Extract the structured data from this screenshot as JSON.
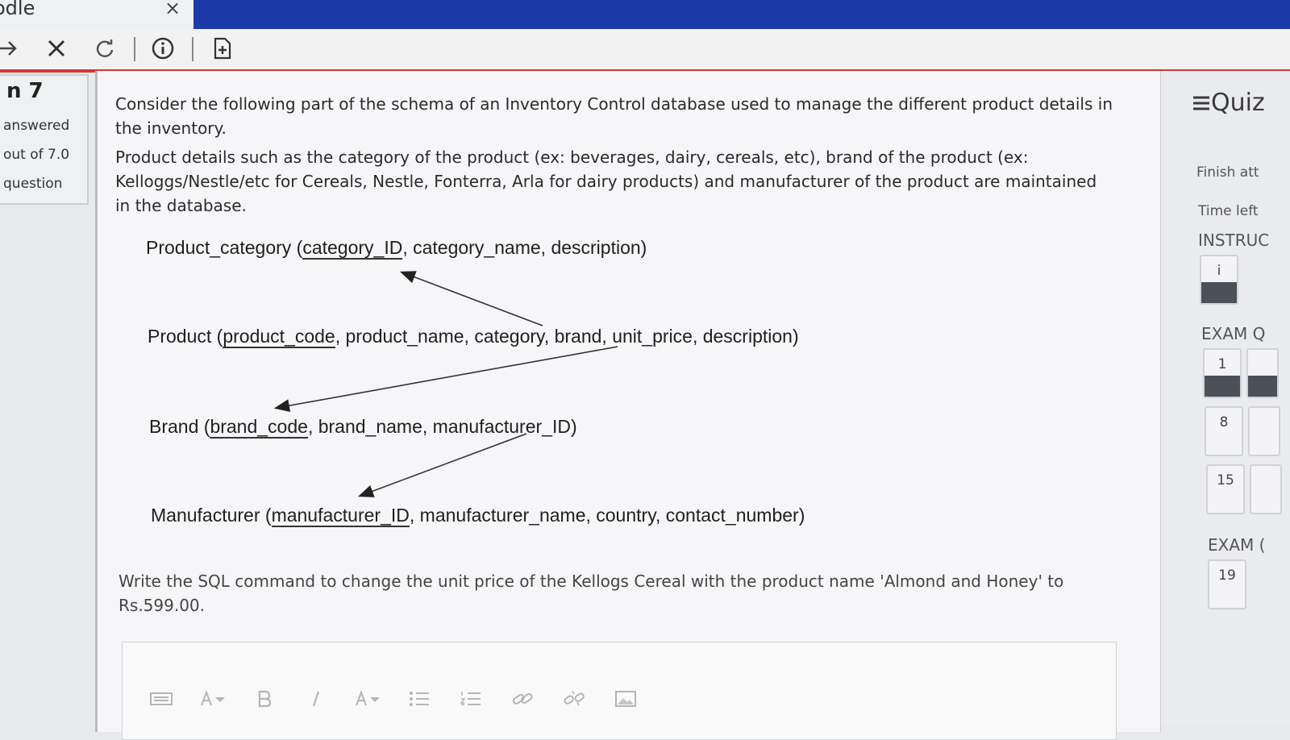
{
  "browser": {
    "tab_title": "odle",
    "tab_close": "×"
  },
  "question_info": {
    "number": "n 7",
    "status": "answered",
    "marks": "out of 7.0",
    "flag": "question"
  },
  "question": {
    "intro": "Consider the following part of the schema of an Inventory Control database used to manage the different product details in the inventory.",
    "details": "Product details such as the category of the product (ex: beverages, dairy, cereals, etc), brand of the product (ex: Kelloggs/Nestle/etc for Cereals, Nestle, Fonterra, Arla for dairy products) and manufacturer of the product are maintained in the database.",
    "schema": {
      "product_category": {
        "name": "Product_category (",
        "pk": "category_ID",
        "rest": ", category_name, description)"
      },
      "product": {
        "name": "Product (",
        "pk": "product_code",
        "rest": ", product_name, category, brand, unit_price, description)"
      },
      "brand": {
        "name": "Brand (",
        "pk": "brand_code",
        "rest": ", brand_name, manufacturer_ID)"
      },
      "manufacturer": {
        "name": "Manufacturer (",
        "pk": "manufacturer_ID",
        "rest": ", manufacturer_name, country, contact_number)"
      }
    },
    "task": "Write the SQL command to change the unit price of the Kellogs Cereal with the product name 'Almond and Honey' to Rs.599.00."
  },
  "quiz_nav": {
    "title": "Quiz",
    "finish": "Finish att",
    "time_left": "Time left",
    "instructions": "INSTRUC",
    "instr_button": "i",
    "exam_q": "EXAM Q",
    "exam_2": "EXAM (",
    "buttons": [
      "1",
      "8",
      "15",
      "19"
    ]
  }
}
